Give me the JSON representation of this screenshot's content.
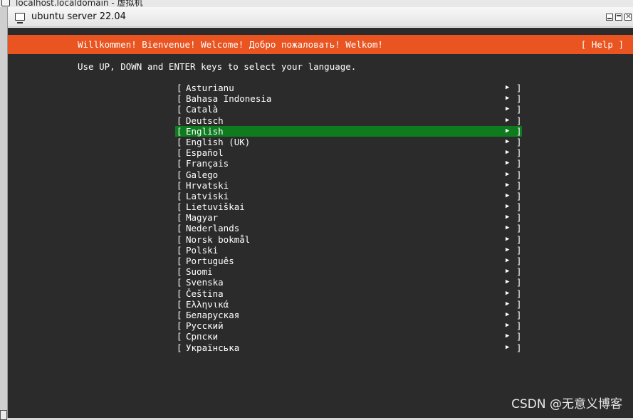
{
  "host": {
    "title": "localhost.localdomain - 虚拟机"
  },
  "vm": {
    "title": "ubuntu server 22.04"
  },
  "header": {
    "welcome": "Willkommen! Bienvenue! Welcome! Добро пожаловать! Welkom!",
    "help": "[ Help ]"
  },
  "instruction": "Use UP, DOWN and ENTER keys to select your language.",
  "languages": {
    "selected_index": 4,
    "items": [
      {
        "label": "Asturianu"
      },
      {
        "label": "Bahasa Indonesia"
      },
      {
        "label": "Català"
      },
      {
        "label": "Deutsch"
      },
      {
        "label": "English"
      },
      {
        "label": "English (UK)"
      },
      {
        "label": "Español"
      },
      {
        "label": "Français"
      },
      {
        "label": "Galego"
      },
      {
        "label": "Hrvatski"
      },
      {
        "label": "Latviski"
      },
      {
        "label": "Lietuviškai"
      },
      {
        "label": "Magyar"
      },
      {
        "label": "Nederlands"
      },
      {
        "label": "Norsk bokmål"
      },
      {
        "label": "Polski"
      },
      {
        "label": "Português"
      },
      {
        "label": "Suomi"
      },
      {
        "label": "Svenska"
      },
      {
        "label": "Čeština"
      },
      {
        "label": "Ελληνικά"
      },
      {
        "label": "Беларуская"
      },
      {
        "label": "Русский"
      },
      {
        "label": "Српски"
      },
      {
        "label": "Українська"
      }
    ],
    "left_bracket": "[",
    "right_bracket": "]",
    "arrow": "▶"
  },
  "watermark": "CSDN @无意义博客",
  "colors": {
    "header_orange": "#e95420",
    "selected_green": "#0f7b1f",
    "terminal_bg": "#2b2b2b"
  }
}
